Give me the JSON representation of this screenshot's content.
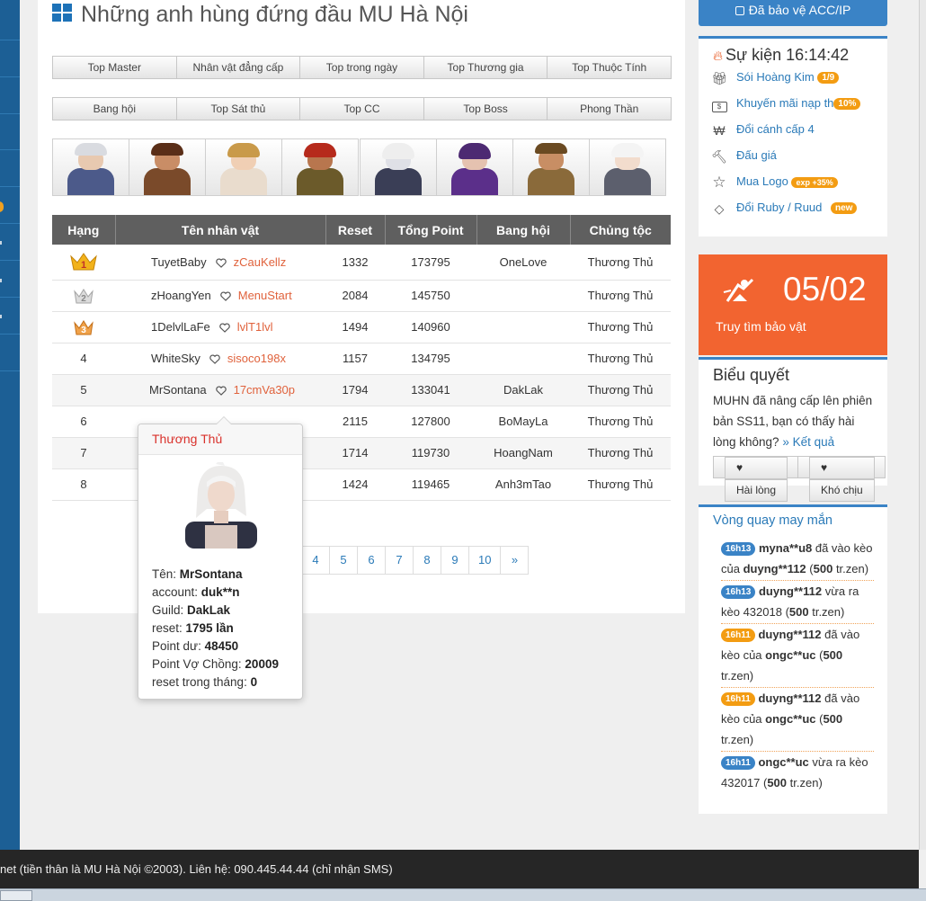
{
  "page_title": "Những anh hùng đứng đầu MU Hà Nội",
  "tab_rows": [
    [
      "Top Master",
      "Nhân vật đẳng cấp",
      "Top trong ngày",
      "Top Thương gia",
      "Top Thuộc Tính"
    ],
    [
      "Bang hội",
      "Top Sát thủ",
      "Top CC",
      "Top Boss",
      "Phong Thần"
    ]
  ],
  "table": {
    "headers": [
      "Hạng",
      "Tên nhân vật",
      "Reset",
      "Tổng Point",
      "Bang hội",
      "Chủng tộc"
    ],
    "rows": [
      {
        "rank": "1",
        "name": "TuyetBaby",
        "spouse": "zCauKellz",
        "reset": "1332",
        "point": "173795",
        "guild": "OneLove",
        "race": "Thương Thủ"
      },
      {
        "rank": "2",
        "name": "zHoangYen",
        "spouse": "MenuStart",
        "reset": "2084",
        "point": "145750",
        "guild": "",
        "race": "Thương Thủ"
      },
      {
        "rank": "3",
        "name": "1DelvlLaFe",
        "spouse": "lvlT1lvl",
        "reset": "1494",
        "point": "140960",
        "guild": "",
        "race": "Thương Thủ"
      },
      {
        "rank": "4",
        "name": "WhiteSky",
        "spouse": "sisoco198x",
        "reset": "1157",
        "point": "134795",
        "guild": "",
        "race": "Thương Thủ"
      },
      {
        "rank": "5",
        "name": "MrSontana",
        "spouse": "17cmVa30p",
        "reset": "1794",
        "point": "133041",
        "guild": "DakLak",
        "race": "Thương Thủ"
      },
      {
        "rank": "6",
        "name": "",
        "spouse": "",
        "reset": "2115",
        "point": "127800",
        "guild": "BoMayLa",
        "race": "Thương Thủ"
      },
      {
        "rank": "7",
        "name": "",
        "spouse": "",
        "reset": "1714",
        "point": "119730",
        "guild": "HoangNam",
        "race": "Thương Thủ"
      },
      {
        "rank": "8",
        "name": "",
        "spouse": "",
        "reset": "1424",
        "point": "119465",
        "guild": "Anh3mTao",
        "race": "Thương Thủ"
      }
    ]
  },
  "pagination": [
    "4",
    "5",
    "6",
    "7",
    "8",
    "9",
    "10",
    "»"
  ],
  "tooltip": {
    "title": "Thương Thủ",
    "lines": [
      {
        "label": "Tên: ",
        "value": "MrSontana"
      },
      {
        "label": "account: ",
        "value": "duk**n"
      },
      {
        "label": "Guild: ",
        "value": "DakLak"
      },
      {
        "label": "reset: ",
        "value": "1795 lần"
      },
      {
        "label": "Point dư: ",
        "value": "48450"
      },
      {
        "label": "Point Vợ Chồng: ",
        "value": "20009"
      },
      {
        "label": "reset trong tháng: ",
        "value": "0"
      }
    ]
  },
  "sidebar": {
    "acc_button": "Đã bảo vệ ACC/IP",
    "event_title": "Sự kiện 16:14:42",
    "events": [
      {
        "label": "Sói Hoàng Kim",
        "badge": "1/9",
        "icon": "gift-icon"
      },
      {
        "label": "Khuyến mãi nạp th",
        "badge": "10%",
        "icon": "money-icon"
      },
      {
        "label": "Đổi cánh cấp 4",
        "badge": "",
        "icon": "won-icon"
      },
      {
        "label": "Đấu giá",
        "badge": "",
        "icon": "gavel-icon"
      },
      {
        "label": "Mua Logo",
        "badge": "exp +35%",
        "icon": "star-icon"
      },
      {
        "label": "Đổi Ruby / Ruud",
        "badge": "new",
        "icon": "diamond-icon"
      }
    ],
    "treasure_count": "05/02",
    "treasure_label": "Truy tìm bảo vật",
    "poll_title": "Biểu quyết",
    "poll_question": "MUHN đã nâng cấp lên phiên bản SS11, bạn có thấy hài lòng không?",
    "poll_result_link": "» Kết quả",
    "poll_buttons": [
      "Hài lòng",
      "Khó chịu"
    ],
    "wheel_title": "Vòng quay may mắn",
    "wheel_items": [
      {
        "time": "16h13",
        "color": "blue",
        "user": "myna**u8",
        "text1": " đã vào kèo của ",
        "target": "duyng**112",
        "text2": " (",
        "amount": "500",
        "text3": " tr.zen)"
      },
      {
        "time": "16h13",
        "color": "blue",
        "user": "duyng**112",
        "text1": " vừa ra kèo 432018 (",
        "target": "",
        "text2": "",
        "amount": "500",
        "text3": " tr.zen)"
      },
      {
        "time": "16h11",
        "color": "orange",
        "user": "duyng**112",
        "text1": " đã vào kèo của ",
        "target": "ongc**uc",
        "text2": " (",
        "amount": "500",
        "text3": " tr.zen)"
      },
      {
        "time": "16h11",
        "color": "orange",
        "user": "duyng**112",
        "text1": " đã vào kèo của ",
        "target": "ongc**uc",
        "text2": " (",
        "amount": "500",
        "text3": " tr.zen)"
      },
      {
        "time": "16h11",
        "color": "blue",
        "user": "ongc**uc",
        "text1": " vừa ra kèo 432017 (",
        "target": "",
        "text2": "",
        "amount": "500",
        "text3": " tr.zen)"
      }
    ]
  },
  "footer": "net (tiền thân là MU Hà Nội ©2003). Liên hệ: 090.445.44.44 (chỉ nhận SMS)",
  "colors": {
    "accent": "#3a83c6",
    "treasure": "#f26430",
    "race": "#d9312b",
    "spouse": "#e0623c"
  }
}
